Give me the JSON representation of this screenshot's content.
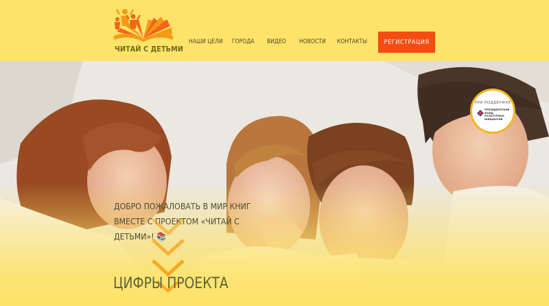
{
  "brand": {
    "name": "ЧИТАЙ С ДЕТЬМИ"
  },
  "nav": {
    "items": [
      {
        "label": "НАШИ ЦЕЛИ"
      },
      {
        "label": "ГОРОДА"
      },
      {
        "label": "ВИДЕО"
      },
      {
        "label": "НОВОСТИ"
      },
      {
        "label": "КОНТАКТЫ"
      }
    ],
    "register_label": "РЕГИСТРАЦИЯ"
  },
  "hero": {
    "welcome": "ДОБРО ПОЖАЛОВАТЬ В МИР КНИГ ВМЕСТЕ С ПРОЕКТОМ «ЧИТАЙ С ДЕТЬМИ»! 📚",
    "section_title": "ЦИФРЫ ПРОЕКТА"
  },
  "support_badge": {
    "top": "ПРИ ПОДДЕРЖКЕ",
    "text": "ПРЕЗИДЕНТСКИЙ ФОНД КУЛЬТУРНЫХ ИНИЦИАТИВ"
  },
  "colors": {
    "header_bg": "#fee36a",
    "accent": "#f44d12",
    "logo_orange": "#f49a16",
    "badge_border": "#f2b51e"
  }
}
